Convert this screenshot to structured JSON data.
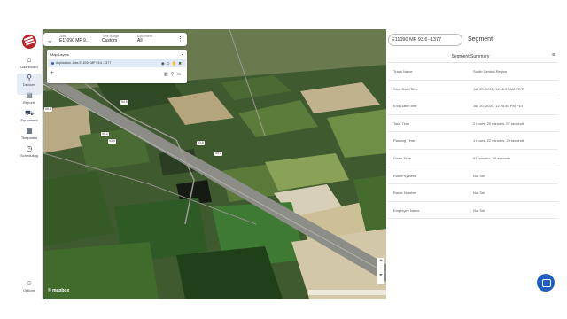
{
  "nav": {
    "items": [
      {
        "label": "Dashboard",
        "icon": "home-icon",
        "glyph": "⌂"
      },
      {
        "label": "Devices",
        "icon": "map-pin-icon",
        "glyph": "⚲"
      },
      {
        "label": "Reports",
        "icon": "document-icon",
        "glyph": "▤"
      },
      {
        "label": "Equipment",
        "icon": "truck-icon",
        "glyph": "⛟"
      },
      {
        "label": "Templates",
        "icon": "template-icon",
        "glyph": "▦"
      },
      {
        "label": "Scheduling",
        "icon": "clock-icon",
        "glyph": "◷"
      }
    ],
    "options_label": "Options",
    "options_glyph": "☺"
  },
  "filters": {
    "icon": "filter-icon",
    "groups": [
      {
        "caption": "Jobs",
        "value": "E11090 MP 9..."
      },
      {
        "caption": "Time Range",
        "value": "Custom"
      },
      {
        "caption": "Equipment",
        "value": "All"
      }
    ]
  },
  "layers": {
    "title": "Map Layers",
    "layer_name": "Application Jobs E11090 MP 93.6 -1377",
    "add_glyph": "+"
  },
  "map": {
    "pins": [
      "95.3",
      "94.9",
      "93.2",
      "93.9",
      "93.8",
      "93.3"
    ],
    "attribution": "© mapbox"
  },
  "segment": {
    "id": "E11090 MP 93.6 -1377",
    "label": "Segment",
    "summary_title": "Segment Summary",
    "rows": [
      {
        "key": "Track Name",
        "value": "South Central Region"
      },
      {
        "key": "Start Date/Time",
        "value": "Jul. 20, 2020, 11:06:57 AM PDT"
      },
      {
        "key": "End Date/Time",
        "value": "Jul. 20, 2020, 12:25:40 PM PDT"
      },
      {
        "key": "Total Time",
        "value": "2 hours, 20 minutes, 57 seconds"
      },
      {
        "key": "Passing Time",
        "value": "1 hours, 22 minutes, 29 seconds"
      },
      {
        "key": "Down Time",
        "value": "57 minutes, 48 seconds"
      },
      {
        "key": "Route System",
        "value": "Not Set"
      },
      {
        "key": "Route Number",
        "value": "Not Set"
      },
      {
        "key": "Employee Name",
        "value": "Not Set"
      }
    ]
  },
  "colors": {
    "brand": "#b7222b",
    "accent": "#2e64b4",
    "chat": "#1f5fbf"
  }
}
